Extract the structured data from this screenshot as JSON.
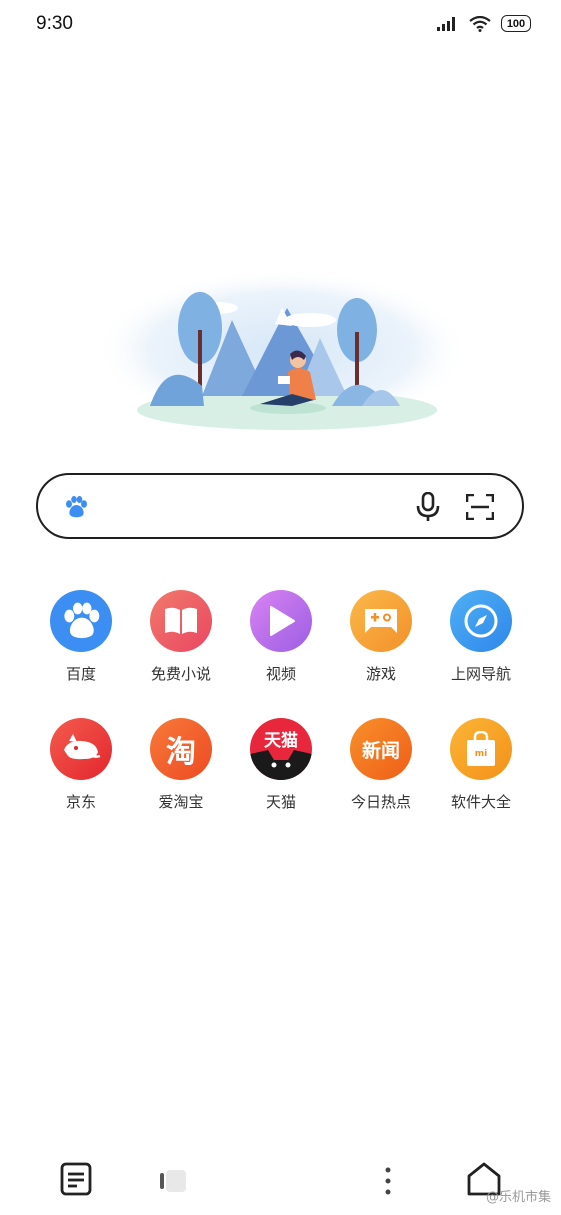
{
  "status_bar": {
    "time": "9:30",
    "battery": "100",
    "signal_icon": "signal-icon",
    "wifi_icon": "wifi-icon"
  },
  "search": {
    "placeholder": "",
    "value": "",
    "left_icon": "baidu-paw-icon",
    "voice_icon": "microphone-icon",
    "scan_icon": "scan-icon"
  },
  "apps": [
    {
      "label": "百度",
      "icon": "baidu-paw-icon",
      "color": "#3d8ef2"
    },
    {
      "label": "免费小说",
      "icon": "book-icon",
      "color": "#ef5a63"
    },
    {
      "label": "视频",
      "icon": "play-icon",
      "color": "#b86ee8"
    },
    {
      "label": "游戏",
      "icon": "gamepad-icon",
      "color": "#f7a23a"
    },
    {
      "label": "上网导航",
      "icon": "compass-icon",
      "color": "#3a9bf0"
    },
    {
      "label": "京东",
      "icon": "jd-dog-icon",
      "color": "#ea3b3b"
    },
    {
      "label": "爱淘宝",
      "icon": "taobao-icon",
      "color": "#f45a2a",
      "logo_text": "淘"
    },
    {
      "label": "天猫",
      "icon": "tmall-icon",
      "color": "#e8273c",
      "logo_text": "天猫"
    },
    {
      "label": "今日热点",
      "icon": "news-icon",
      "color": "#f3731f",
      "logo_text": "新闻"
    },
    {
      "label": "软件大全",
      "icon": "shopping-bag-icon",
      "color": "#f7a21e",
      "logo_text": "mi"
    }
  ],
  "bottom_nav": {
    "notes_icon": "notes-icon",
    "tabs_icon": "tabs-icon",
    "menu_icon": "more-vertical-icon",
    "home_icon": "home-icon"
  },
  "watermark": "@乐机市集"
}
